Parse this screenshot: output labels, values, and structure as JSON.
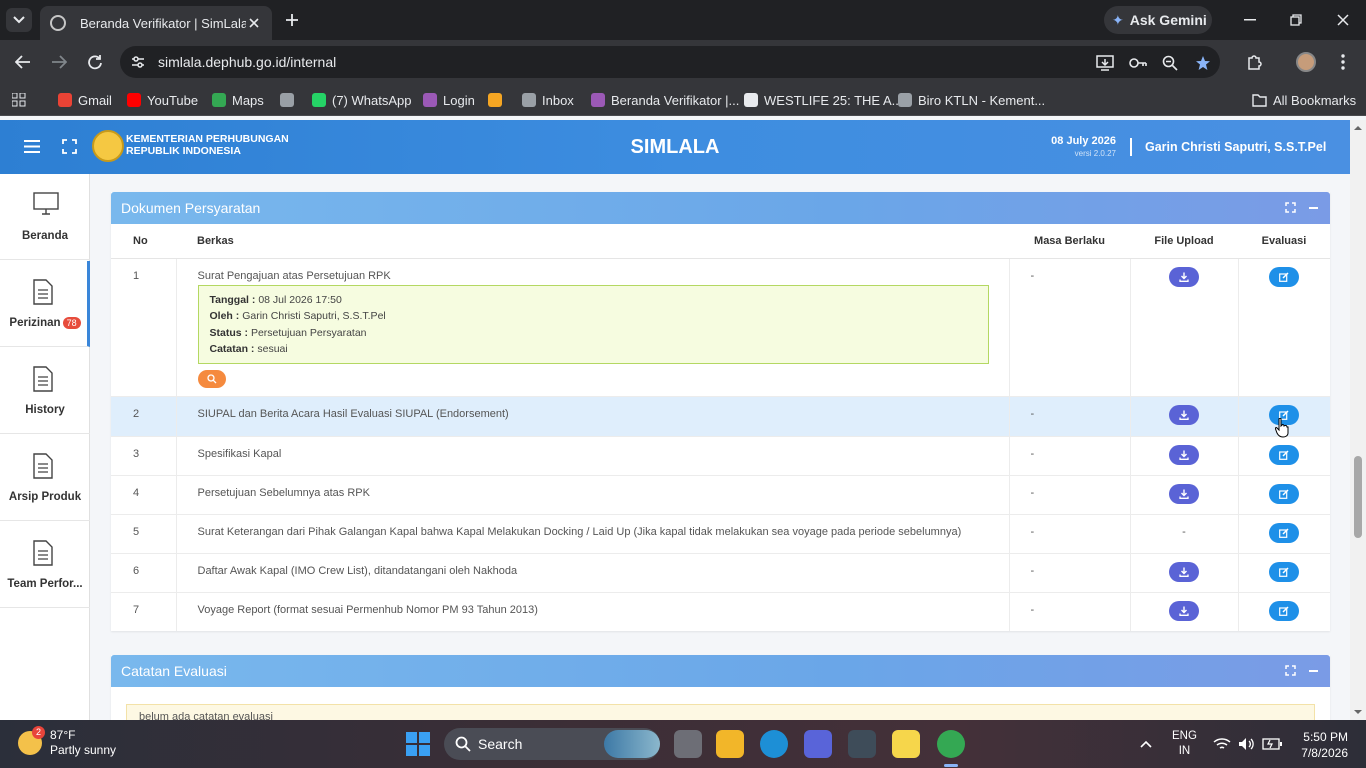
{
  "browser": {
    "tab_title": "Beranda Verifikator | SimLala",
    "url": "simlala.dephub.go.id/internal",
    "gemini_label": "Ask Gemini",
    "bookmarks": [
      {
        "label": "Gmail",
        "icon": "gmail-icon",
        "color": "#ea4335"
      },
      {
        "label": "YouTube",
        "icon": "youtube-icon",
        "color": "#ff0000"
      },
      {
        "label": "Maps",
        "icon": "maps-icon",
        "color": "#34a853"
      },
      {
        "label": "",
        "icon": "globe-icon",
        "color": "#9aa0a6"
      },
      {
        "label": "(7) WhatsApp",
        "icon": "whatsapp-icon",
        "color": "#25d366"
      },
      {
        "label": "Login",
        "icon": "login-icon",
        "color": "#9b59b6"
      },
      {
        "label": "",
        "icon": "pinwheel-icon",
        "color": "#f5a623"
      },
      {
        "label": "Inbox",
        "icon": "mail-icon",
        "color": "#9aa0a6"
      },
      {
        "label": "Beranda Verifikator |...",
        "icon": "simlala-icon",
        "color": "#9b59b6"
      },
      {
        "label": "WESTLIFE 25: THE A...",
        "icon": "page-icon",
        "color": "#e8eaed"
      },
      {
        "label": "Biro KTLN - Kement...",
        "icon": "globe-icon",
        "color": "#9aa0a6"
      }
    ],
    "all_bookmarks": "All Bookmarks"
  },
  "app": {
    "org_line1": "KEMENTERIAN PERHUBUNGAN",
    "org_line2": "REPUBLIK INDONESIA",
    "title": "SIMLALA",
    "date": "08 July 2026",
    "version": "versi 2.0.27",
    "user": "Garin Christi Saputri, S.S.T.Pel"
  },
  "sidebar": {
    "items": [
      {
        "label": "Beranda",
        "icon": "monitor-icon"
      },
      {
        "label": "Perizinan",
        "icon": "document-icon",
        "badge": "78"
      },
      {
        "label": "History",
        "icon": "document-icon"
      },
      {
        "label": "Arsip Produk",
        "icon": "document-icon"
      },
      {
        "label": "Team Perfor...",
        "icon": "document-icon"
      }
    ]
  },
  "dokumen": {
    "title": "Dokumen Persyaratan",
    "columns": {
      "no": "No",
      "berkas": "Berkas",
      "masa": "Masa Berlaku",
      "file": "File Upload",
      "evaluasi": "Evaluasi"
    },
    "rows": [
      {
        "no": "1",
        "berkas": "Surat Pengajuan atas Persetujuan RPK",
        "masa": "-",
        "file_upload": true
      },
      {
        "no": "2",
        "berkas": "SIUPAL dan Berita Acara Hasil Evaluasi SIUPAL (Endorsement)",
        "masa": "-",
        "file_upload": true
      },
      {
        "no": "3",
        "berkas": "Spesifikasi Kapal",
        "masa": "-",
        "file_upload": true
      },
      {
        "no": "4",
        "berkas": "Persetujuan Sebelumnya atas RPK",
        "masa": "-",
        "file_upload": true
      },
      {
        "no": "5",
        "berkas": "Surat Keterangan dari Pihak Galangan Kapal bahwa Kapal Melakukan Docking / Laid Up (Jika kapal tidak melakukan sea voyage pada periode sebelumnya)",
        "masa": "-",
        "file_upload": false,
        "file_text": "-"
      },
      {
        "no": "6",
        "berkas": "Daftar Awak Kapal (IMO Crew List), ditandatangani oleh Nakhoda",
        "masa": "-",
        "file_upload": true
      },
      {
        "no": "7",
        "berkas": "Voyage Report (format sesuai Permenhub Nomor PM 93 Tahun 2013)",
        "masa": "-",
        "file_upload": true
      }
    ],
    "note": {
      "tanggal_label": "Tanggal :",
      "tanggal": "08 Jul 2026 17:50",
      "oleh_label": "Oleh :",
      "oleh": "Garin Christi Saputri, S.S.T.Pel",
      "status_label": "Status :",
      "status": "Persetujuan Persyaratan",
      "catatan_label": "Catatan :",
      "catatan": "sesuai"
    }
  },
  "catatan": {
    "title": "Catatan Evaluasi",
    "text": "belum ada catatan evaluasi"
  },
  "taskbar": {
    "temp": "87°F",
    "weather": "Partly sunny",
    "weather_badge": "2",
    "search": "Search",
    "lang1": "ENG",
    "lang2": "IN",
    "time": "5:50 PM",
    "date": "7/8/2026"
  }
}
